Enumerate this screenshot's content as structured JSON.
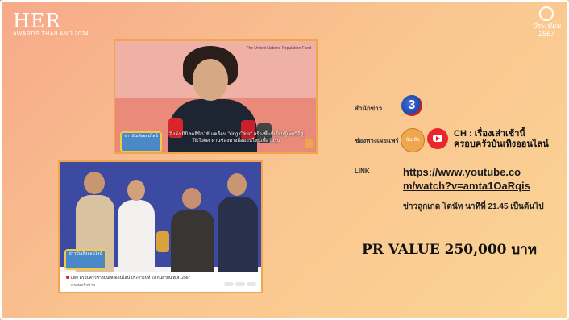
{
  "logo": {
    "title": "HER",
    "subtitle": "AWARDS THAILAND 2024"
  },
  "seal": {
    "text": "ปีระเบียน 2567"
  },
  "screenshot1": {
    "banner_line1": "The United Nations Population Fund",
    "caption": "'อิ๋งอ๋ง มินิสคลินิก' ขับเคลื่อน 'Ying Clinic' สร้างพื้นที่เรียนรู้เพศวิถีสู่ TikToker ผ่านช่องทางสื่อออนไลน์เพื่อวัยรุ่น",
    "channel_badge": "ข่าวบันเทิงออนไลน์"
  },
  "screenshot2": {
    "video_title": "Live ครอบครัวข่าวบันเทิงออนไลน์ ประจำวันที่ 19 กันยายน พ.ศ. 2567",
    "channel": "ครอบครัวข่าว",
    "channel_badge": "ข่าวบันเทิงออนไลน์"
  },
  "info": {
    "agency_label": "สำนักข่าว",
    "agency_logo": "ch3-logo",
    "channel_label": "ช่องทางเผยแพร่",
    "channel_name_line1": "CH : เรื่องเล่าเช้านี้",
    "channel_name_line2": "ครอบครัวบันเทิงออนไลน์",
    "link_label": "LINK",
    "link_line1": "https://www.youtube.co",
    "link_line2": "m/watch?v=amta1OaRqis",
    "time_note": "ข่าวลูกเกด โตนัท นาทีที่ 21.45 เป็นต้นไป",
    "pr_value": "PR VALUE  250,000 บาท"
  },
  "colors": {
    "accent": "#f0a64c",
    "youtube": "#e8262b",
    "bg_start": "#f7a989",
    "bg_end": "#fbd595"
  }
}
